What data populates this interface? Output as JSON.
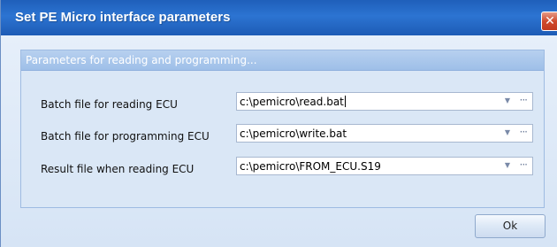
{
  "window": {
    "title": "Set PE Micro interface parameters",
    "close_glyph": "✕"
  },
  "group": {
    "title": "Parameters for reading and programming..."
  },
  "fields": [
    {
      "label": "Batch file for reading ECU",
      "value": "c:\\pemicro\\read.bat"
    },
    {
      "label": "Batch file for programming ECU",
      "value": "c:\\pemicro\\write.bat"
    },
    {
      "label": "Result file when reading ECU",
      "value": "c:\\pemicro\\FROM_ECU.S19"
    }
  ],
  "icons": {
    "dropdown": "▼",
    "ellipsis": "···"
  },
  "buttons": {
    "ok_label": "Ok"
  },
  "colors": {
    "titlebar": "#2c74d2",
    "close": "#cf4a2d",
    "group_header": "#9ebfe8",
    "background": "#d6e4f5"
  }
}
